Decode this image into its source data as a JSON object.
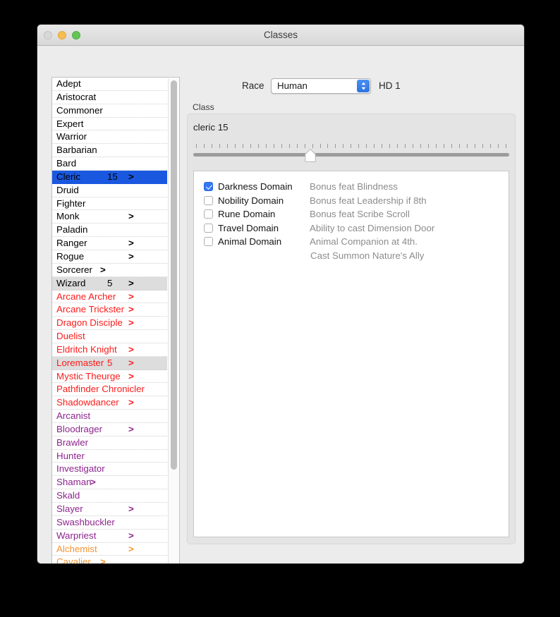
{
  "window": {
    "title": "Classes",
    "traffic_lights": [
      "close",
      "minimize",
      "maximize"
    ]
  },
  "class_list": {
    "scroll_position": "top",
    "rows": [
      {
        "name": "Adept",
        "level": "",
        "arrow": "",
        "color": "black",
        "state": "normal"
      },
      {
        "name": "Aristocrat",
        "level": "",
        "arrow": "",
        "color": "black",
        "state": "normal"
      },
      {
        "name": "Commoner",
        "level": "",
        "arrow": "",
        "color": "black",
        "state": "normal"
      },
      {
        "name": "Expert",
        "level": "",
        "arrow": "",
        "color": "black",
        "state": "normal"
      },
      {
        "name": "Warrior",
        "level": "",
        "arrow": "",
        "color": "black",
        "state": "normal"
      },
      {
        "name": "Barbarian",
        "level": "",
        "arrow": "",
        "color": "black",
        "state": "normal"
      },
      {
        "name": "Bard",
        "level": "",
        "arrow": "",
        "color": "black",
        "state": "normal"
      },
      {
        "name": "Cleric",
        "level": "15",
        "arrow": ">",
        "color": "black",
        "state": "selected"
      },
      {
        "name": "Druid",
        "level": "",
        "arrow": "",
        "color": "black",
        "state": "normal"
      },
      {
        "name": "Fighter",
        "level": "",
        "arrow": "",
        "color": "black",
        "state": "normal"
      },
      {
        "name": "Monk",
        "level": "",
        "arrow": ">",
        "color": "black",
        "state": "normal"
      },
      {
        "name": "Paladin",
        "level": "",
        "arrow": "",
        "color": "black",
        "state": "normal"
      },
      {
        "name": "Ranger",
        "level": "",
        "arrow": ">",
        "color": "black",
        "state": "normal"
      },
      {
        "name": "Rogue",
        "level": "",
        "arrow": ">",
        "color": "black",
        "state": "normal"
      },
      {
        "name": "Sorcerer",
        "level": "",
        "arrow": ">",
        "color": "black",
        "state": "normal",
        "arrow_near": true
      },
      {
        "name": "Wizard",
        "level": "5",
        "arrow": ">",
        "color": "black",
        "state": "shaded"
      },
      {
        "name": "Arcane Archer",
        "level": "",
        "arrow": ">",
        "color": "red",
        "state": "normal"
      },
      {
        "name": "Arcane Trickster",
        "level": "",
        "arrow": ">",
        "color": "red",
        "state": "normal"
      },
      {
        "name": "Dragon Disciple",
        "level": "",
        "arrow": ">",
        "color": "red",
        "state": "normal"
      },
      {
        "name": "Duelist",
        "level": "",
        "arrow": "",
        "color": "red",
        "state": "normal"
      },
      {
        "name": "Eldritch Knight",
        "level": "",
        "arrow": ">",
        "color": "red",
        "state": "normal"
      },
      {
        "name": "Loremaster",
        "level": "5",
        "arrow": ">",
        "color": "red",
        "state": "shaded"
      },
      {
        "name": "Mystic Theurge",
        "level": "",
        "arrow": ">",
        "color": "red",
        "state": "normal"
      },
      {
        "name": "Pathfinder Chronicler",
        "level": "",
        "arrow": "",
        "color": "red",
        "state": "normal"
      },
      {
        "name": "Shadowdancer",
        "level": "",
        "arrow": ">",
        "color": "red",
        "state": "normal"
      },
      {
        "name": "Arcanist",
        "level": "",
        "arrow": "",
        "color": "purple",
        "state": "normal"
      },
      {
        "name": "Bloodrager",
        "level": "",
        "arrow": ">",
        "color": "purple",
        "state": "normal"
      },
      {
        "name": "Brawler",
        "level": "",
        "arrow": "",
        "color": "purple",
        "state": "normal"
      },
      {
        "name": "Hunter",
        "level": "",
        "arrow": "",
        "color": "purple",
        "state": "normal"
      },
      {
        "name": "Investigator",
        "level": "",
        "arrow": "",
        "color": "purple",
        "state": "normal"
      },
      {
        "name": "Shaman",
        "level": "",
        "arrow": ">",
        "color": "purple",
        "state": "normal",
        "arrow_near": true
      },
      {
        "name": "Skald",
        "level": "",
        "arrow": "",
        "color": "purple",
        "state": "normal"
      },
      {
        "name": "Slayer",
        "level": "",
        "arrow": ">",
        "color": "purple",
        "state": "normal"
      },
      {
        "name": "Swashbuckler",
        "level": "",
        "arrow": "",
        "color": "purple",
        "state": "normal"
      },
      {
        "name": "Warpriest",
        "level": "",
        "arrow": ">",
        "color": "purple",
        "state": "normal"
      },
      {
        "name": "Alchemist",
        "level": "",
        "arrow": ">",
        "color": "orange",
        "state": "normal"
      },
      {
        "name": "Cavalier",
        "level": "",
        "arrow": ">",
        "color": "orange",
        "state": "normal",
        "arrow_near": true
      }
    ]
  },
  "race": {
    "label": "Race",
    "selected": "Human",
    "hd_label": "HD 1"
  },
  "class_group": {
    "label": "Class",
    "summary": "cleric 15",
    "slider": {
      "tick_count": 41,
      "value_percent": 37
    }
  },
  "domains": [
    {
      "name": "Darkness Domain",
      "checked": true,
      "description": "Bonus feat Blindness",
      "description2": ""
    },
    {
      "name": "Nobility Domain",
      "checked": false,
      "description": "Bonus feat Leadership if 8th",
      "description2": ""
    },
    {
      "name": "Rune Domain",
      "checked": false,
      "description": "Bonus feat Scribe Scroll",
      "description2": ""
    },
    {
      "name": "Travel Domain",
      "checked": false,
      "description": "Ability to cast Dimension Door",
      "description2": ""
    },
    {
      "name": "Animal Domain",
      "checked": false,
      "description": "Animal Companion at 4th.",
      "description2": "Cast Summon Nature's Ally"
    }
  ],
  "colors": {
    "selection_blue": "#1a58e0",
    "checkbox_blue": "#3478f6",
    "red_class": "#fd1b1b",
    "purple_class": "#8d248d",
    "orange_class": "#f59430"
  }
}
